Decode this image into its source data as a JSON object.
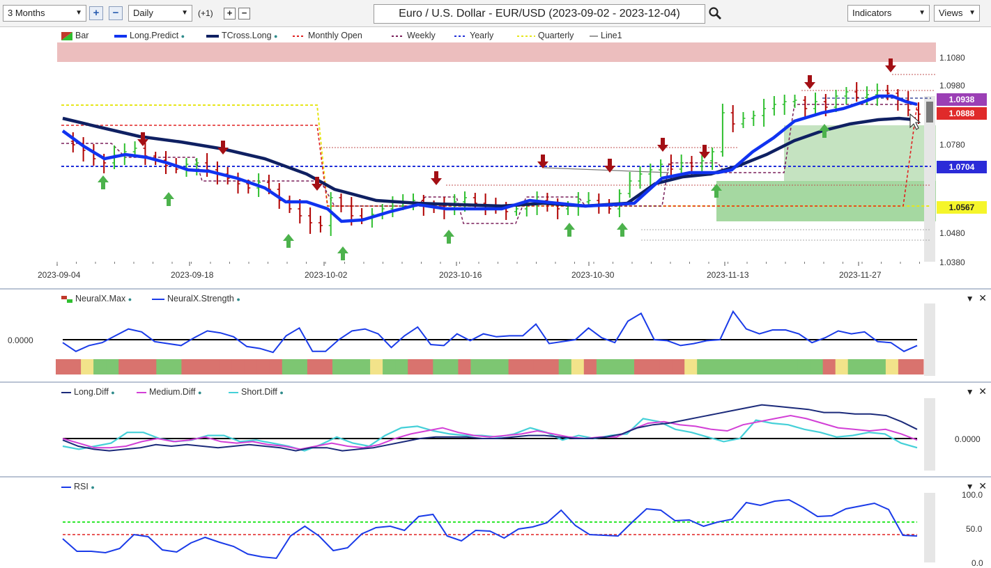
{
  "toolbar": {
    "range": "3 Months",
    "interval": "Daily",
    "offset": "(+1)",
    "title": "Euro / U.S. Dollar - EUR/USD (2023-09-02 - 2023-12-04)",
    "indicators": "Indicators",
    "views": "Views"
  },
  "main_panel": {
    "legend": [
      "Bar",
      "Long.Predict",
      "TCross.Long",
      "Monthly Open",
      "Weekly",
      "Yearly",
      "Quarterly",
      "Line1"
    ],
    "y_ticks": [
      "1.1080",
      "1.0980",
      "1.0780",
      "1.0480",
      "1.0380"
    ],
    "x_ticks": [
      "2023-09-04",
      "2023-09-18",
      "2023-10-02",
      "2023-10-16",
      "2023-10-30",
      "2023-11-13",
      "2023-11-27"
    ],
    "tags": [
      {
        "label": "1.0938",
        "color": "#9b3fb5"
      },
      {
        "label": "1.0888",
        "color": "#e02a2a"
      },
      {
        "label": "1.0704",
        "color": "#2b2bd8"
      },
      {
        "label": "1.0567",
        "color": "#f5f52a"
      }
    ]
  },
  "neural_panel": {
    "legend": [
      "NeuralX.Max",
      "NeuralX.Strength"
    ],
    "zero_label": "0.0000",
    "strip": [
      "r",
      "r",
      "y",
      "g",
      "g",
      "r",
      "r",
      "r",
      "g",
      "g",
      "r",
      "r",
      "r",
      "r",
      "r",
      "r",
      "r",
      "r",
      "g",
      "g",
      "r",
      "r",
      "g",
      "g",
      "g",
      "y",
      "g",
      "g",
      "r",
      "r",
      "g",
      "g",
      "r",
      "g",
      "g",
      "g",
      "r",
      "r",
      "r",
      "r",
      "g",
      "y",
      "r",
      "g",
      "g",
      "g",
      "r",
      "r",
      "r",
      "r",
      "y",
      "g",
      "g",
      "g",
      "g",
      "g",
      "g",
      "g",
      "g",
      "g",
      "g",
      "r",
      "y",
      "g",
      "g",
      "g",
      "y",
      "r",
      "r"
    ],
    "strength": [
      -0.3,
      -1.2,
      -0.6,
      -0.3,
      0.4,
      1.1,
      0.8,
      -0.2,
      -0.4,
      -0.6,
      0.2,
      0.9,
      0.7,
      0.3,
      -0.7,
      -0.9,
      -1.3,
      0.4,
      1.2,
      -1.2,
      -1.2,
      0.0,
      0.9,
      1.1,
      0.6,
      -0.8,
      0.4,
      1.3,
      -0.5,
      -0.6,
      0.6,
      -0.1,
      0.6,
      0.3,
      0.4,
      0.4,
      1.6,
      -0.4,
      -0.2,
      0.0,
      1.2,
      0.2,
      -0.3,
      1.9,
      2.7,
      0.0,
      -0.1,
      -0.6,
      -0.4,
      -0.1,
      0.0,
      2.9,
      1.1,
      0.6,
      1.0,
      1.0,
      0.6,
      -0.3,
      0.2,
      0.9,
      0.6,
      0.8,
      -0.2,
      -0.3,
      -1.2,
      -0.6
    ]
  },
  "diff_panel": {
    "legend": [
      "Long.Diff",
      "Medium.Diff",
      "Short.Diff"
    ],
    "zero_label": "0.0000",
    "long": [
      -0.1,
      -0.5,
      -0.7,
      -0.8,
      -0.7,
      -0.6,
      -0.4,
      -0.5,
      -0.4,
      -0.5,
      -0.6,
      -0.5,
      -0.4,
      -0.5,
      -0.6,
      -0.8,
      -0.6,
      -0.6,
      -0.8,
      -0.7,
      -0.6,
      -0.4,
      -0.2,
      0.0,
      0.1,
      0.1,
      0.1,
      0.0,
      0.0,
      0.1,
      0.2,
      0.2,
      0.1,
      0.0,
      0.0,
      0.1,
      0.3,
      0.7,
      0.9,
      1.0,
      1.2,
      1.4,
      1.6,
      1.8,
      2.0,
      2.2,
      2.1,
      2.0,
      1.9,
      1.7,
      1.7,
      1.6,
      1.6,
      1.5,
      1.1,
      0.6
    ],
    "medium": [
      0.0,
      -0.3,
      -0.6,
      -0.6,
      -0.5,
      -0.2,
      0.0,
      -0.2,
      -0.1,
      0.1,
      -0.2,
      -0.3,
      -0.2,
      -0.4,
      -0.5,
      -0.7,
      -0.5,
      -0.3,
      -0.5,
      -0.6,
      -0.4,
      0.0,
      0.3,
      0.5,
      0.7,
      0.4,
      0.2,
      0.1,
      0.2,
      0.3,
      0.5,
      0.3,
      0.1,
      0.0,
      0.1,
      0.1,
      0.6,
      1.0,
      1.1,
      0.9,
      0.8,
      0.6,
      0.5,
      0.9,
      1.1,
      1.3,
      1.5,
      1.3,
      1.0,
      0.7,
      0.6,
      0.5,
      0.6,
      0.3,
      -0.1
    ],
    "short": [
      -0.5,
      -0.7,
      -0.5,
      -0.3,
      0.4,
      0.4,
      0.0,
      -0.2,
      -0.1,
      0.2,
      0.2,
      -0.2,
      -0.1,
      -0.3,
      -0.5,
      -0.8,
      -0.4,
      0.1,
      -0.3,
      -0.5,
      0.2,
      0.7,
      0.8,
      0.5,
      0.3,
      0.2,
      0.2,
      0.1,
      0.3,
      0.7,
      0.4,
      -0.1,
      0.2,
      0.0,
      0.2,
      0.3,
      1.3,
      1.1,
      0.6,
      0.4,
      0.1,
      -0.2,
      0.0,
      1.2,
      1.0,
      0.9,
      0.6,
      0.4,
      0.1,
      0.2,
      0.4,
      0.3,
      -0.3,
      -0.6
    ]
  },
  "rsi_panel": {
    "legend": [
      "RSI"
    ],
    "y_ticks": [
      "100.0",
      "50.0",
      "0.0"
    ],
    "values": [
      36,
      18,
      18,
      16,
      22,
      42,
      39,
      20,
      17,
      30,
      38,
      31,
      25,
      14,
      10,
      8,
      40,
      54,
      40,
      19,
      23,
      43,
      52,
      54,
      48,
      68,
      71,
      40,
      33,
      48,
      47,
      37,
      50,
      53,
      59,
      77,
      55,
      42,
      41,
      40,
      60,
      79,
      77,
      62,
      63,
      54,
      60,
      64,
      88,
      84,
      90,
      92,
      81,
      68,
      69,
      79,
      83,
      87,
      78,
      41,
      40
    ]
  },
  "colors": {
    "panel_bg": "#ffffff",
    "long_predict": "#1033f0",
    "tcross": "#0f2062",
    "bull": "#2fbf2f",
    "bear": "#b00000"
  }
}
